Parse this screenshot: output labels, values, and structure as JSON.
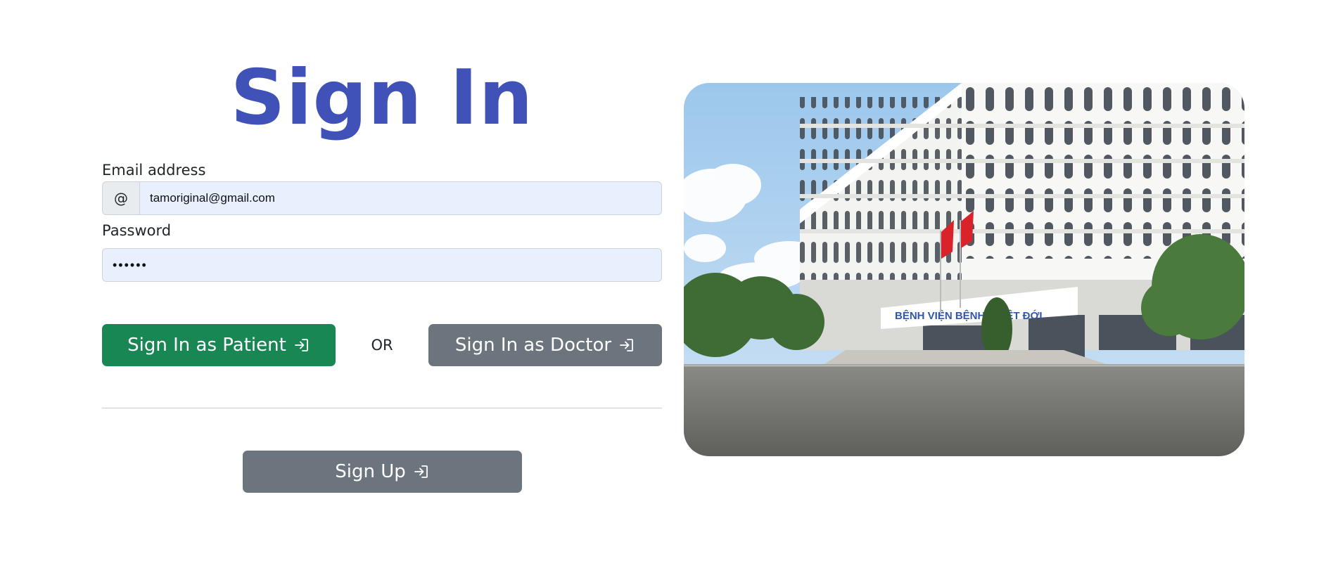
{
  "signin": {
    "title": "Sign In",
    "email_label": "Email address",
    "email_prefix": "@",
    "email_value": "tamoriginal@gmail.com",
    "password_label": "Password",
    "password_value": "••••••",
    "patient_button": "Sign In as Patient",
    "or_text": "OR",
    "doctor_button": "Sign In as Doctor",
    "signup_button": "Sign Up",
    "button_icon": "box-arrow-in-right-icon"
  },
  "photo": {
    "sign_text": "BỆNH VIỆN BỆNH NHIỆT ĐỚI"
  },
  "colors": {
    "title": "#4052b8",
    "patient_button": "#198754",
    "secondary_button": "#6c757d",
    "input_fill": "#e8f0fe"
  }
}
